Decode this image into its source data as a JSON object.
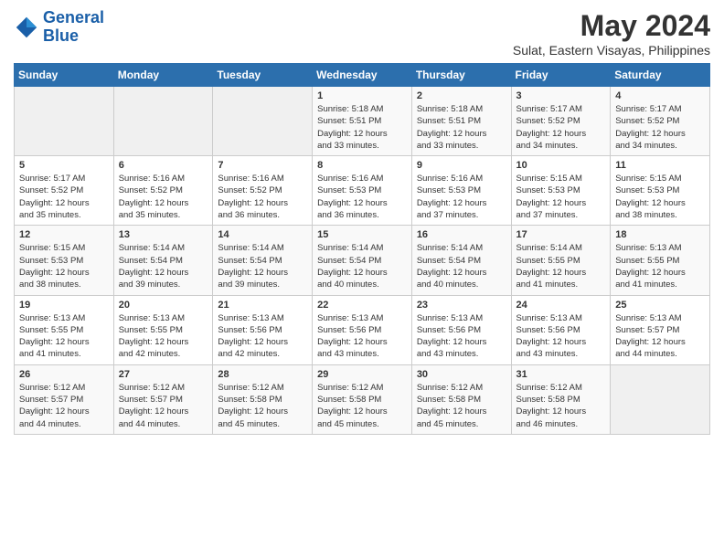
{
  "header": {
    "logo_line1": "General",
    "logo_line2": "Blue",
    "title": "May 2024",
    "subtitle": "Sulat, Eastern Visayas, Philippines"
  },
  "days_of_week": [
    "Sunday",
    "Monday",
    "Tuesday",
    "Wednesday",
    "Thursday",
    "Friday",
    "Saturday"
  ],
  "weeks": [
    [
      {
        "day": "",
        "content": ""
      },
      {
        "day": "",
        "content": ""
      },
      {
        "day": "",
        "content": ""
      },
      {
        "day": "1",
        "content": "Sunrise: 5:18 AM\nSunset: 5:51 PM\nDaylight: 12 hours\nand 33 minutes."
      },
      {
        "day": "2",
        "content": "Sunrise: 5:18 AM\nSunset: 5:51 PM\nDaylight: 12 hours\nand 33 minutes."
      },
      {
        "day": "3",
        "content": "Sunrise: 5:17 AM\nSunset: 5:52 PM\nDaylight: 12 hours\nand 34 minutes."
      },
      {
        "day": "4",
        "content": "Sunrise: 5:17 AM\nSunset: 5:52 PM\nDaylight: 12 hours\nand 34 minutes."
      }
    ],
    [
      {
        "day": "5",
        "content": "Sunrise: 5:17 AM\nSunset: 5:52 PM\nDaylight: 12 hours\nand 35 minutes."
      },
      {
        "day": "6",
        "content": "Sunrise: 5:16 AM\nSunset: 5:52 PM\nDaylight: 12 hours\nand 35 minutes."
      },
      {
        "day": "7",
        "content": "Sunrise: 5:16 AM\nSunset: 5:52 PM\nDaylight: 12 hours\nand 36 minutes."
      },
      {
        "day": "8",
        "content": "Sunrise: 5:16 AM\nSunset: 5:53 PM\nDaylight: 12 hours\nand 36 minutes."
      },
      {
        "day": "9",
        "content": "Sunrise: 5:16 AM\nSunset: 5:53 PM\nDaylight: 12 hours\nand 37 minutes."
      },
      {
        "day": "10",
        "content": "Sunrise: 5:15 AM\nSunset: 5:53 PM\nDaylight: 12 hours\nand 37 minutes."
      },
      {
        "day": "11",
        "content": "Sunrise: 5:15 AM\nSunset: 5:53 PM\nDaylight: 12 hours\nand 38 minutes."
      }
    ],
    [
      {
        "day": "12",
        "content": "Sunrise: 5:15 AM\nSunset: 5:53 PM\nDaylight: 12 hours\nand 38 minutes."
      },
      {
        "day": "13",
        "content": "Sunrise: 5:14 AM\nSunset: 5:54 PM\nDaylight: 12 hours\nand 39 minutes."
      },
      {
        "day": "14",
        "content": "Sunrise: 5:14 AM\nSunset: 5:54 PM\nDaylight: 12 hours\nand 39 minutes."
      },
      {
        "day": "15",
        "content": "Sunrise: 5:14 AM\nSunset: 5:54 PM\nDaylight: 12 hours\nand 40 minutes."
      },
      {
        "day": "16",
        "content": "Sunrise: 5:14 AM\nSunset: 5:54 PM\nDaylight: 12 hours\nand 40 minutes."
      },
      {
        "day": "17",
        "content": "Sunrise: 5:14 AM\nSunset: 5:55 PM\nDaylight: 12 hours\nand 41 minutes."
      },
      {
        "day": "18",
        "content": "Sunrise: 5:13 AM\nSunset: 5:55 PM\nDaylight: 12 hours\nand 41 minutes."
      }
    ],
    [
      {
        "day": "19",
        "content": "Sunrise: 5:13 AM\nSunset: 5:55 PM\nDaylight: 12 hours\nand 41 minutes."
      },
      {
        "day": "20",
        "content": "Sunrise: 5:13 AM\nSunset: 5:55 PM\nDaylight: 12 hours\nand 42 minutes."
      },
      {
        "day": "21",
        "content": "Sunrise: 5:13 AM\nSunset: 5:56 PM\nDaylight: 12 hours\nand 42 minutes."
      },
      {
        "day": "22",
        "content": "Sunrise: 5:13 AM\nSunset: 5:56 PM\nDaylight: 12 hours\nand 43 minutes."
      },
      {
        "day": "23",
        "content": "Sunrise: 5:13 AM\nSunset: 5:56 PM\nDaylight: 12 hours\nand 43 minutes."
      },
      {
        "day": "24",
        "content": "Sunrise: 5:13 AM\nSunset: 5:56 PM\nDaylight: 12 hours\nand 43 minutes."
      },
      {
        "day": "25",
        "content": "Sunrise: 5:13 AM\nSunset: 5:57 PM\nDaylight: 12 hours\nand 44 minutes."
      }
    ],
    [
      {
        "day": "26",
        "content": "Sunrise: 5:12 AM\nSunset: 5:57 PM\nDaylight: 12 hours\nand 44 minutes."
      },
      {
        "day": "27",
        "content": "Sunrise: 5:12 AM\nSunset: 5:57 PM\nDaylight: 12 hours\nand 44 minutes."
      },
      {
        "day": "28",
        "content": "Sunrise: 5:12 AM\nSunset: 5:58 PM\nDaylight: 12 hours\nand 45 minutes."
      },
      {
        "day": "29",
        "content": "Sunrise: 5:12 AM\nSunset: 5:58 PM\nDaylight: 12 hours\nand 45 minutes."
      },
      {
        "day": "30",
        "content": "Sunrise: 5:12 AM\nSunset: 5:58 PM\nDaylight: 12 hours\nand 45 minutes."
      },
      {
        "day": "31",
        "content": "Sunrise: 5:12 AM\nSunset: 5:58 PM\nDaylight: 12 hours\nand 46 minutes."
      },
      {
        "day": "",
        "content": ""
      }
    ]
  ]
}
